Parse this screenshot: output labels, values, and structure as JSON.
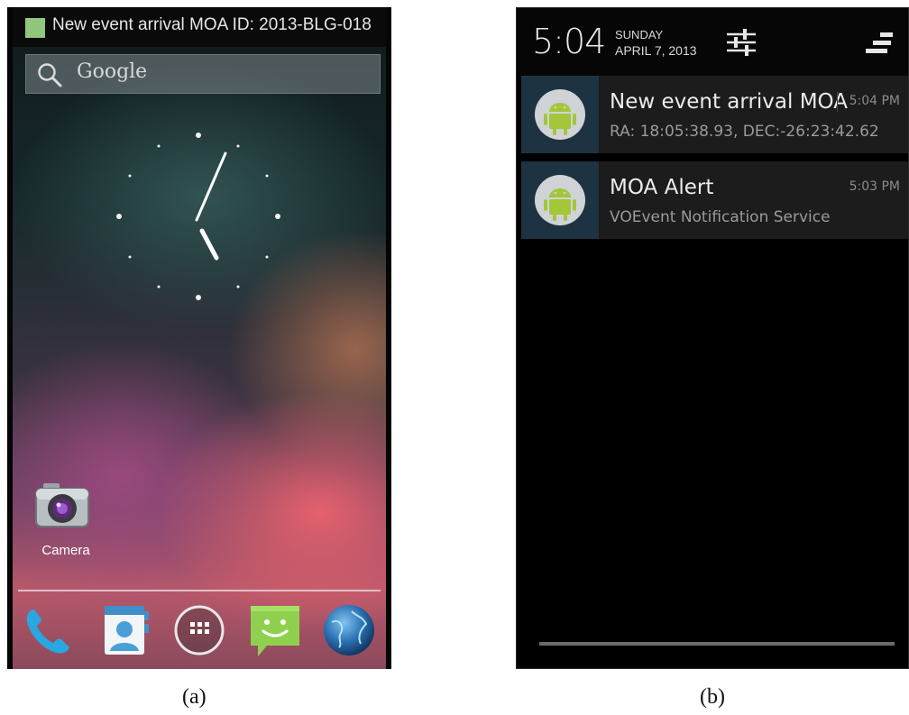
{
  "panel_a": {
    "caption": "(a)",
    "status_bar": {
      "notification_text": "New event arrival MOA ID: 2013-BLG-018",
      "notification_icon_color": "#8fc77c"
    },
    "search_bar": {
      "label": "Google",
      "icon": "search-icon"
    },
    "clock": {
      "type": "analog",
      "icon": "analog-clock"
    },
    "app_shortcut": {
      "label": "Camera",
      "icon": "camera-icon"
    },
    "dock": [
      {
        "icon": "phone-icon"
      },
      {
        "icon": "contacts-icon"
      },
      {
        "icon": "app-drawer-icon"
      },
      {
        "icon": "messaging-icon"
      },
      {
        "icon": "browser-globe-icon"
      }
    ]
  },
  "panel_b": {
    "caption": "(b)",
    "header": {
      "time": "5:04",
      "day": "SUNDAY",
      "date": "APRIL 7, 2013",
      "settings_icon": "quick-settings-icon",
      "clear_icon": "clear-all-icon"
    },
    "notifications": [
      {
        "title": "New event arrival MOA",
        "subtitle": "RA: 18:05:38.93, DEC:-26:23:42.62",
        "time": "5:04 PM",
        "icon": "android-app-icon"
      },
      {
        "title": "MOA Alert",
        "subtitle": "VOEvent Notification Service",
        "time": "5:03 PM",
        "icon": "android-app-icon"
      }
    ]
  },
  "colors": {
    "android_green": "#a4c639",
    "notification_bg": "#1c1c1c",
    "avatar_bg": "#1d3342"
  }
}
